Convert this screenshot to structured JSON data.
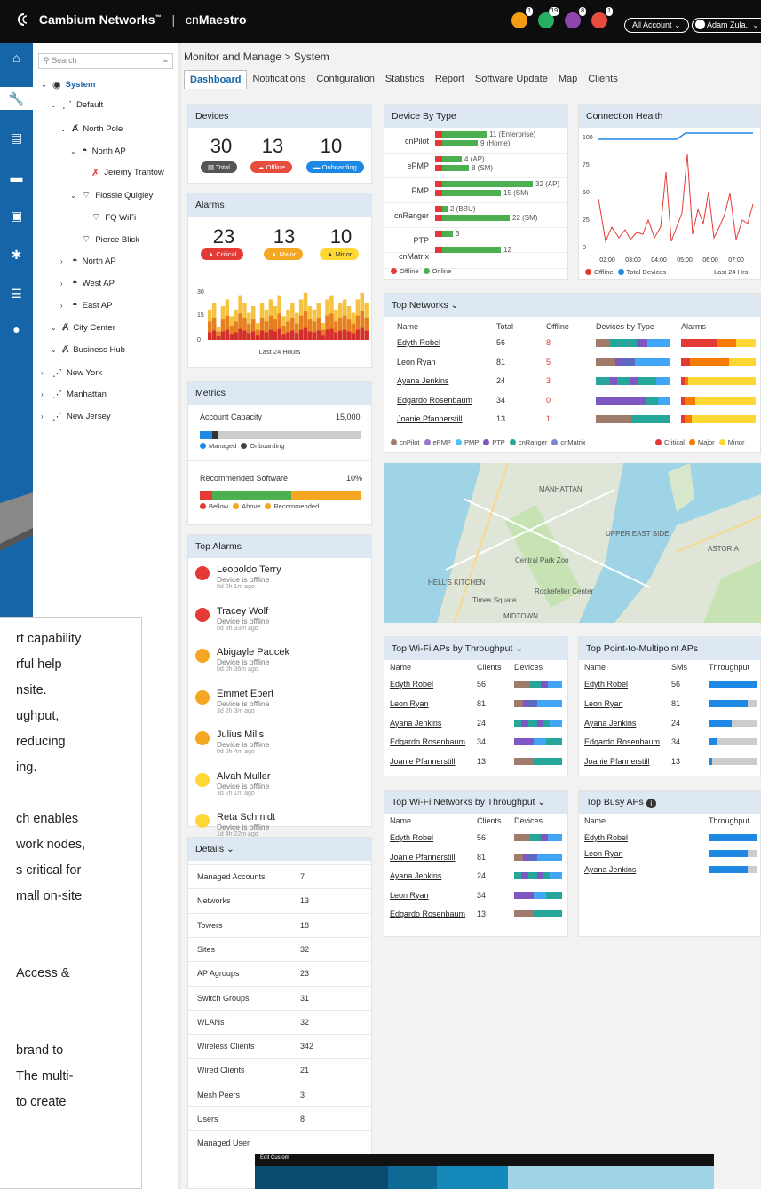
{
  "app": {
    "brand": "Cambium Networks",
    "tm": "™",
    "product_pre": "cn",
    "product_bold": "Maestro",
    "account": "All Account",
    "user": "Adam Zula.."
  },
  "notifications": [
    {
      "icon": "bell-icon",
      "count": "1",
      "color": "#f39c12"
    },
    {
      "icon": "truck-icon",
      "count": "19",
      "color": "#27ae60"
    },
    {
      "icon": "clipboard-icon",
      "count": "8",
      "color": "#8e44ad"
    },
    {
      "icon": "refresh-icon",
      "count": "1",
      "color": "#e74c3c"
    }
  ],
  "tree": {
    "search_placeholder": "Search",
    "items": [
      {
        "label": "System",
        "level": 0,
        "arrow": "v",
        "icon": "globe-icon"
      },
      {
        "label": "Default",
        "level": 1,
        "arrow": "v",
        "icon": "network-icon"
      },
      {
        "label": "North Pole",
        "level": 2,
        "arrow": "v",
        "icon": "tower-icon"
      },
      {
        "label": "North AP",
        "level": 3,
        "arrow": "v",
        "icon": "ap-icon"
      },
      {
        "label": "Jeremy Trantow",
        "level": 4,
        "arrow": "",
        "icon": "wifi-off-icon"
      },
      {
        "label": "Flossie Quigley",
        "level": 3,
        "arrow": "v",
        "icon": "wifi-icon"
      },
      {
        "label": "FQ WiFi",
        "level": 4,
        "arrow": "",
        "icon": "wifi-icon"
      },
      {
        "label": "Pierce Blick",
        "level": 3,
        "arrow": "",
        "icon": "wifi-icon"
      },
      {
        "label": "North AP",
        "level": 2,
        "arrow": ">",
        "icon": "ap-icon"
      },
      {
        "label": "West AP",
        "level": 2,
        "arrow": ">",
        "icon": "ap-icon"
      },
      {
        "label": "East AP",
        "level": 2,
        "arrow": ">",
        "icon": "ap-icon"
      },
      {
        "label": "City Center",
        "level": 1,
        "arrow": "v",
        "icon": "tower-icon"
      },
      {
        "label": "Business Hub",
        "level": 1,
        "arrow": "v",
        "icon": "tower-icon"
      },
      {
        "label": "New York",
        "level": 0,
        "arrow": ">",
        "icon": "network-icon"
      },
      {
        "label": "Manhattan",
        "level": 0,
        "arrow": ">",
        "icon": "network-icon"
      },
      {
        "label": "New Jersey",
        "level": 0,
        "arrow": ">",
        "icon": "network-icon"
      }
    ]
  },
  "breadcrumb": "Monitor and Manage > System",
  "tabs": [
    "Dashboard",
    "Notifications",
    "Configuration",
    "Statistics",
    "Report",
    "Software Update",
    "Map",
    "Clients"
  ],
  "devices": {
    "title": "Devices",
    "total": "30",
    "offline": "13",
    "onboarding": "10",
    "total_label": "Total",
    "offline_label": "Offline",
    "onboarding_label": "Onboarding"
  },
  "alarms": {
    "title": "Alarms",
    "critical": "23",
    "major": "13",
    "minor": "10",
    "critical_label": "Critical",
    "major_label": "Major",
    "minor_label": "Minor",
    "y_ticks": [
      "30",
      "15",
      "0"
    ],
    "xlabel": "Last 24 Hours"
  },
  "metrics": {
    "title": "Metrics",
    "capacity_label": "Account Capacity",
    "capacity_value": "15,000",
    "managed": "Managed",
    "onboarding": "Onboarding",
    "software_label": "Recommended Software",
    "software_value": "10%",
    "bellow": "Bellow",
    "above": "Above",
    "recommended": "Recommended"
  },
  "top_alarms": {
    "title": "Top Alarms",
    "items": [
      {
        "name": "Leopoldo Terry",
        "desc": "Device is offline",
        "time": "0d 0h 1m ago",
        "level": "critical"
      },
      {
        "name": "Tracey Wolf",
        "desc": "Device is offline",
        "time": "0d 3h 33m ago",
        "level": "critical"
      },
      {
        "name": "Abigayle Paucek",
        "desc": "Device is offline",
        "time": "0d 0h 36m ago",
        "level": "major"
      },
      {
        "name": "Emmet Ebert",
        "desc": "Device is offline",
        "time": "3d 2h 3m ago",
        "level": "major"
      },
      {
        "name": "Julius Mills",
        "desc": "Device is offline",
        "time": "0d 0h 4m ago",
        "level": "major"
      },
      {
        "name": "Alvah Muller",
        "desc": "Device is offline",
        "time": "3d 2h 1m ago",
        "level": "minor"
      },
      {
        "name": "Reta Schmidt",
        "desc": "Device is offline",
        "time": "1d 4h 22m ago",
        "level": "minor"
      }
    ]
  },
  "details": {
    "title": "Details",
    "rows": [
      {
        "k": "Managed Accounts",
        "v": "7"
      },
      {
        "k": "Networks",
        "v": "13"
      },
      {
        "k": "Towers",
        "v": "18"
      },
      {
        "k": "Sites",
        "v": "32"
      },
      {
        "k": "AP Agroups",
        "v": "23"
      },
      {
        "k": "Switch Groups",
        "v": "31"
      },
      {
        "k": "WLANs",
        "v": "32"
      },
      {
        "k": "Wireless Clients",
        "v": "342"
      },
      {
        "k": "Wired Clients",
        "v": "21"
      },
      {
        "k": "Mesh Peers",
        "v": "3"
      },
      {
        "k": "Users",
        "v": "8"
      },
      {
        "k": "Managed User",
        "v": ""
      }
    ]
  },
  "device_by_type": {
    "title": "Device By Type",
    "offline": "Offline",
    "online": "Online",
    "rows": [
      {
        "name": "cnPilot",
        "l1": "11 (Enterprise)",
        "l2": "9 (Home)"
      },
      {
        "name": "ePMP",
        "l1": "4 (AP)",
        "l2": "8 (SM)"
      },
      {
        "name": "PMP",
        "l1": "32 (AP)",
        "l2": "15 (SM)"
      },
      {
        "name": "cnRanger",
        "l1": "2 (BBU)",
        "l2": "22 (SM)"
      },
      {
        "name": "PTP",
        "l1": "3",
        "l2": ""
      },
      {
        "name": "cnMatrix",
        "l1": "12",
        "l2": ""
      }
    ]
  },
  "connection_health": {
    "title": "Connection Health",
    "y_ticks": [
      "100",
      "75",
      "50",
      "25",
      "0"
    ],
    "x_ticks": [
      "02:00",
      "03:00",
      "04:00",
      "05:00",
      "06:00",
      "07:00"
    ],
    "offline": "Offline",
    "total": "Total Devices",
    "range": "Last 24 Hrs"
  },
  "top_networks": {
    "title": "Top Networks",
    "headers": [
      "Name",
      "Total",
      "Offline",
      "Devices by Type",
      "Alarms"
    ],
    "rows": [
      {
        "name": "Edyth Robel",
        "total": "56",
        "offline": "8"
      },
      {
        "name": "Leon Ryan",
        "total": "81",
        "offline": "5"
      },
      {
        "name": "Ayana Jenkins",
        "total": "24",
        "offline": "3"
      },
      {
        "name": "Edgardo Rosenbaum",
        "total": "34",
        "offline": "0"
      },
      {
        "name": "Joanie Pfannerstill",
        "total": "13",
        "offline": "1"
      }
    ],
    "legend": [
      "cnPilot",
      "ePMP",
      "PMP",
      "PTP",
      "cnRanger",
      "cnMatrix"
    ],
    "alarm_legend": [
      "Critical",
      "Major",
      "Minor"
    ]
  },
  "map": {
    "labels": [
      "MANHATTAN",
      "Central Park Zoo",
      "HELL'S KITCHEN",
      "Times Square",
      "Rockefeller Center",
      "MIDTOWN",
      "ASTORIA",
      "UPPER EAST SIDE"
    ]
  },
  "top_wifi_aps": {
    "title": "Top Wi-Fi APs by Throughput",
    "headers": [
      "Name",
      "Clients",
      "Devices"
    ],
    "rows": [
      {
        "name": "Edyth Robel",
        "v": "56"
      },
      {
        "name": "Leon Ryan",
        "v": "81"
      },
      {
        "name": "Ayana Jenkins",
        "v": "24"
      },
      {
        "name": "Edgardo Rosenbaum",
        "v": "34"
      },
      {
        "name": "Joanie Pfannerstill",
        "v": "13"
      }
    ]
  },
  "top_ptmp": {
    "title": "Top Point-to-Multipoint APs",
    "headers": [
      "Name",
      "SMs",
      "Throughput"
    ],
    "rows": [
      {
        "name": "Edyth Robel",
        "v": "56"
      },
      {
        "name": "Leon Ryan",
        "v": "81"
      },
      {
        "name": "Ayana Jenkins",
        "v": "24"
      },
      {
        "name": "Edgardo Rosenbaum",
        "v": "34"
      },
      {
        "name": "Joanie Pfannerstill",
        "v": "13"
      }
    ]
  },
  "top_wifi_networks": {
    "title": "Top Wi-Fi Networks by Throughput",
    "headers": [
      "Name",
      "Clients",
      "Devices"
    ],
    "rows": [
      {
        "name": "Edyth Robel",
        "v": "56"
      },
      {
        "name": "Joanie Pfannerstill",
        "v": "81"
      },
      {
        "name": "Ayana Jenkins",
        "v": "24"
      },
      {
        "name": "Leon Ryan",
        "v": "34"
      },
      {
        "name": "Edgardo Rosenbaum",
        "v": "13"
      }
    ]
  },
  "top_busy": {
    "title": "Top Busy APs",
    "headers": [
      "Name",
      "Throughput"
    ],
    "rows": [
      {
        "name": "Edyth Robel"
      },
      {
        "name": "Leon Ryan"
      },
      {
        "name": "Ayana Jenkins"
      }
    ]
  },
  "overlay_text": [
    "rt capability",
    "rful help",
    "nsite.",
    "ughput,",
    "reducing",
    "ing.",
    "",
    "ch enables",
    "work nodes,",
    "s critical for",
    "mall on-site",
    "",
    "",
    "Access &",
    "",
    "",
    "brand to",
    "The multi-",
    "to create"
  ],
  "popup_title": "Edit Custom"
}
